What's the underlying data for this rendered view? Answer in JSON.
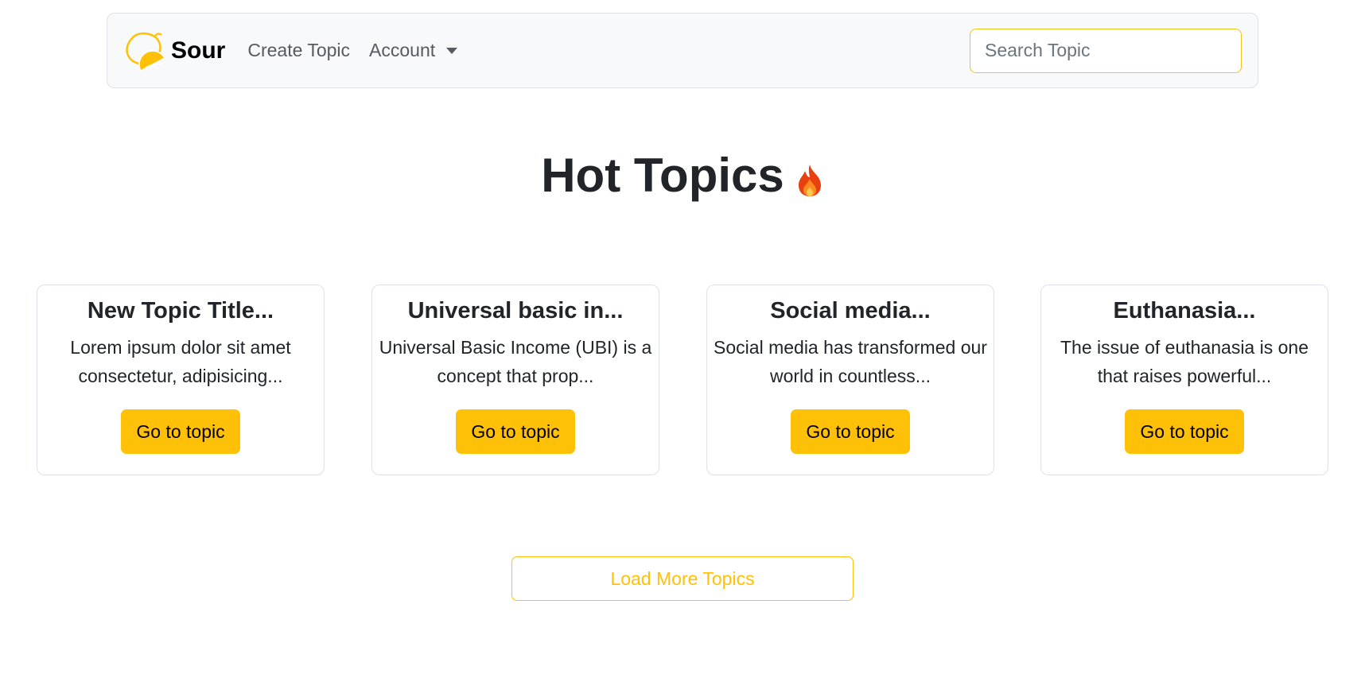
{
  "navbar": {
    "brand_name": "Sour",
    "links": [
      {
        "label": "Create Topic"
      },
      {
        "label": "Account"
      }
    ],
    "search": {
      "placeholder": "Search Topic",
      "value": ""
    }
  },
  "main": {
    "title": "Hot Topics",
    "title_icon": "flame-icon",
    "cards": [
      {
        "title": "New Topic Title...",
        "text": "Lorem ipsum dolor sit amet consectetur, adipisicing...",
        "button": "Go to topic"
      },
      {
        "title": "Universal basic in...",
        "text": "Universal Basic Income (UBI) is a concept that prop...",
        "button": "Go to topic"
      },
      {
        "title": "Social media...",
        "text": "Social media has transformed our world in countless...",
        "button": "Go to topic"
      },
      {
        "title": "Euthanasia...",
        "text": "The issue of euthanasia is one that raises powerful...",
        "button": "Go to topic"
      }
    ],
    "load_more_label": "Load More Topics"
  },
  "colors": {
    "accent": "#ffc107",
    "navbar_bg": "#f8f9fa",
    "text": "#212529"
  }
}
